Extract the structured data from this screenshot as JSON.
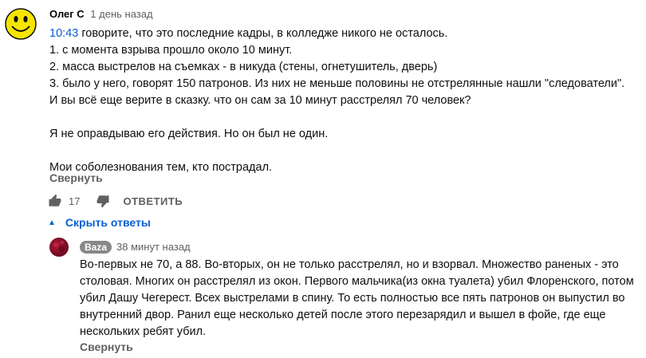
{
  "comment": {
    "author": "Олег С",
    "time": "1 день назад",
    "timestamp_link": "10:43",
    "first_line_rest": " говорите, что это последние кадры, в колледже никого не осталось.",
    "lines": [
      "1. с момента взрыва прошло около 10 минут.",
      "2. масса выстрелов на съемках - в никуда (стены, огнетушитель, дверь)",
      "3. было у него, говорят 150 патронов. Из них не меньше половины не отстрелянные нашли \"следователи\".",
      "И вы всё еще верите в сказку. что он сам за 10 минут расстрелял 70 человек?"
    ],
    "paragraph2": "Я не оправдываю его действия. Но он был не один.",
    "paragraph3": "Мои соболезнования тем, кто пострадал.",
    "collapse_label": "Свернуть",
    "like_count": "17",
    "reply_label": "ОТВЕТИТЬ",
    "hide_replies_label": "Скрыть ответы"
  },
  "reply": {
    "author": "Baza",
    "time": "38 минут назад",
    "lines": [
      "Во-первых не 70, а 88. Во-вторых, он не только расстрелял, но и взорвал. Множество раненых  - это",
      "столовая.  Многих он расстрелял из окон. Первого мальчика(из окна туалета) убил Флоренского, потом",
      "убил Дашу Чегерест. Всех выстрелами в спину.  То есть полностью все пять патронов он выпустил во",
      "внутренний двор. Ранил еще несколько детей после этого перезарядил и вышел в фойе, где еще",
      "нескольких ребят убил."
    ],
    "collapse_label": "Свернуть"
  },
  "icons": {
    "main_avatar": "smiley-face-icon",
    "like": "thumbs-up-icon",
    "dislike": "thumbs-down-icon",
    "caret": "caret-up-icon"
  },
  "colors": {
    "link_blue": "#065fd4",
    "secondary_text": "#606060",
    "avatar_yellow": "#f5e600"
  }
}
